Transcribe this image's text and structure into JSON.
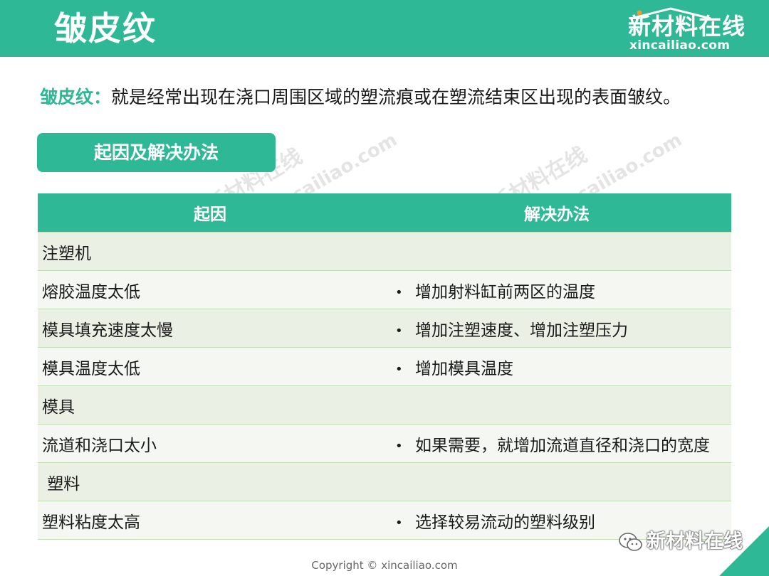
{
  "header": {
    "title": "皱皮纹",
    "logo_cn": "新材料在线",
    "logo_en": "xincailiao.com"
  },
  "definition": {
    "term": "皱皮纹：",
    "text": "就是经常出现在浇口周围区域的塑流痕或在塑流结束区出现的表面皱纹。"
  },
  "section": {
    "label": "起因及解决办法"
  },
  "table": {
    "headers": [
      "起因",
      "解决办法"
    ],
    "rows": [
      {
        "cause": "注塑机",
        "solution": ""
      },
      {
        "cause": "熔胶温度太低",
        "solution": "增加射料缸前两区的温度"
      },
      {
        "cause": "模具填充速度太慢",
        "solution": "增加注塑速度、增加注塑压力"
      },
      {
        "cause": "模具温度太低",
        "solution": "增加模具温度"
      },
      {
        "cause": "模具",
        "solution": ""
      },
      {
        "cause": "流道和浇口太小",
        "solution": "如果需要，就增加流道直径和浇口的宽度"
      },
      {
        "cause": " 塑料",
        "solution": ""
      },
      {
        "cause": "塑料粘度太高",
        "solution": "选择较易流动的塑料级别"
      }
    ]
  },
  "watermark": {
    "cn": "新材料在线",
    "en": "xincailiao.com"
  },
  "wechat_badge": "新材料在线",
  "footer": {
    "copyright": "Copyright © xincailiao.com"
  },
  "colors": {
    "brand_green": "#2eb895",
    "row_tint": "#eaf0e4"
  }
}
